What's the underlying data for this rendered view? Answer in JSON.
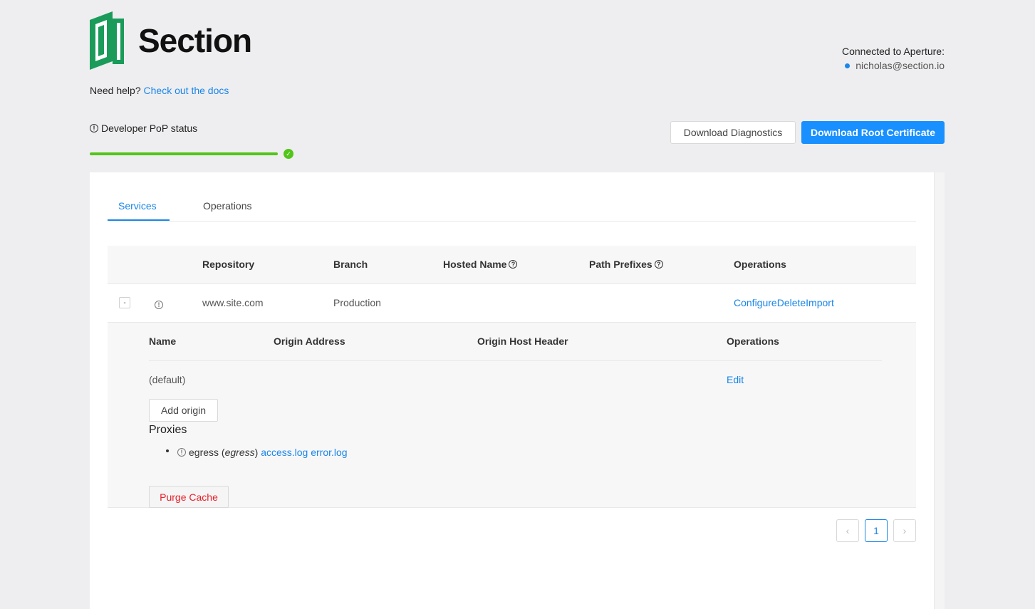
{
  "brand": {
    "name": "Section",
    "logo_icon": "section-logo-icon",
    "accent": "#1a9b5a"
  },
  "help": {
    "prefix": "Need help?",
    "link_label": "Check out the docs"
  },
  "connection": {
    "label": "Connected to Aperture:",
    "user": "nicholas@section.io"
  },
  "status": {
    "label": "Developer PoP status",
    "progress": 1.0,
    "state": "ok"
  },
  "actions": {
    "diagnostics_label": "Download Diagnostics",
    "root_cert_label": "Download Root Certificate"
  },
  "tabs": [
    {
      "label": "Services",
      "active": true
    },
    {
      "label": "Operations",
      "active": false
    }
  ],
  "services_table": {
    "headers": {
      "repository": "Repository",
      "branch": "Branch",
      "hosted_name": "Hosted Name",
      "path_prefixes": "Path Prefixes",
      "operations": "Operations"
    },
    "rows": [
      {
        "expand": "-",
        "repository": "www.site.com",
        "branch": "Production",
        "hosted_name": "",
        "path_prefixes": "",
        "operations": [
          "Configure",
          "Delete",
          "Import"
        ]
      }
    ]
  },
  "origins_table": {
    "headers": {
      "name": "Name",
      "origin_address": "Origin Address",
      "origin_host_header": "Origin Host Header",
      "operations": "Operations"
    },
    "rows": [
      {
        "name": "(default)",
        "origin_address": "",
        "origin_host_header": "",
        "operation": "Edit"
      }
    ],
    "add_label": "Add origin"
  },
  "proxies": {
    "title": "Proxies",
    "items": [
      {
        "name": "egress",
        "type": "egress",
        "logs": [
          "access.log",
          "error.log"
        ]
      }
    ]
  },
  "purge_label": "Purge Cache",
  "pagination": {
    "current": "1",
    "prev_icon": "chevron-left-icon",
    "next_icon": "chevron-right-icon"
  },
  "colors": {
    "primary": "#1890ff",
    "link": "#1a86e8",
    "success": "#52c41a",
    "danger": "#e8202a"
  }
}
